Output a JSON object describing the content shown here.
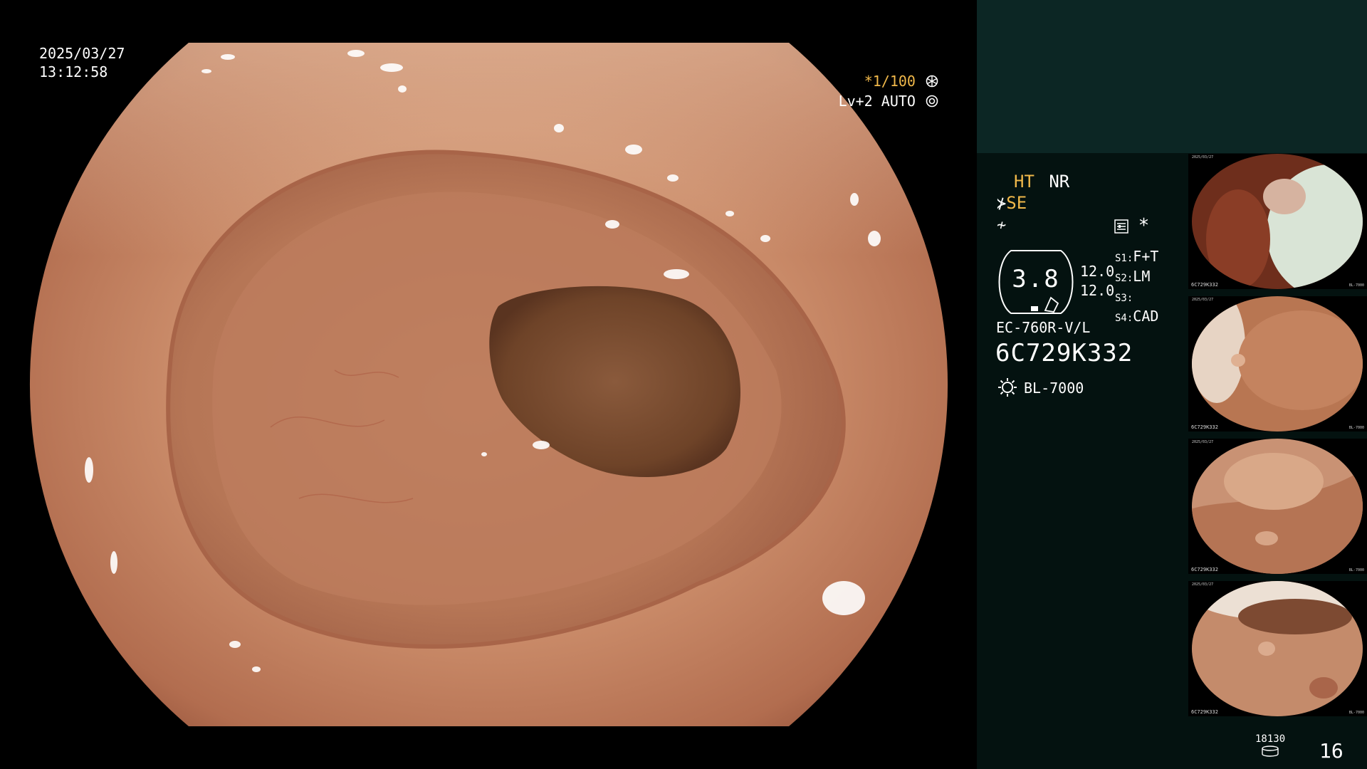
{
  "overlay": {
    "date": "2025/03/27",
    "time": "13:12:58",
    "shutter": "*1/100",
    "level": "Lv+2",
    "iris": "AUTO"
  },
  "panel": {
    "ht": "HT",
    "nr": "NR",
    "se": "SE",
    "f_symbol": "≁",
    "asterisk": "*",
    "gauge_value": "3.8",
    "values": [
      "12.0",
      "12.0"
    ],
    "slots": [
      {
        "key": "S1:",
        "value": "F+T"
      },
      {
        "key": "S2:",
        "value": "LM"
      },
      {
        "key": "S3:",
        "value": ""
      },
      {
        "key": "S4:",
        "value": "CAD"
      }
    ],
    "scope_model": "EC-760R-V/L",
    "scope_serial": "6C729K332",
    "light_source": "BL-7000",
    "storage_count": "18130",
    "image_count": "16"
  },
  "thumbnails": [
    {
      "date": "2025/03/27",
      "serial": "6C729K332",
      "light": "BL-7000"
    },
    {
      "date": "2025/03/27",
      "serial": "6C729K332",
      "light": "BL-7000"
    },
    {
      "date": "2025/03/27",
      "serial": "6C729K332",
      "light": "BL-7000"
    },
    {
      "date": "2025/03/27",
      "serial": "6C729K332",
      "light": "BL-7000"
    }
  ],
  "colors": {
    "accent_orange": "#f0b84a",
    "panel_bg": "#041210",
    "panel_top_bg": "#0c2624",
    "mucosa": "#c98a68"
  }
}
